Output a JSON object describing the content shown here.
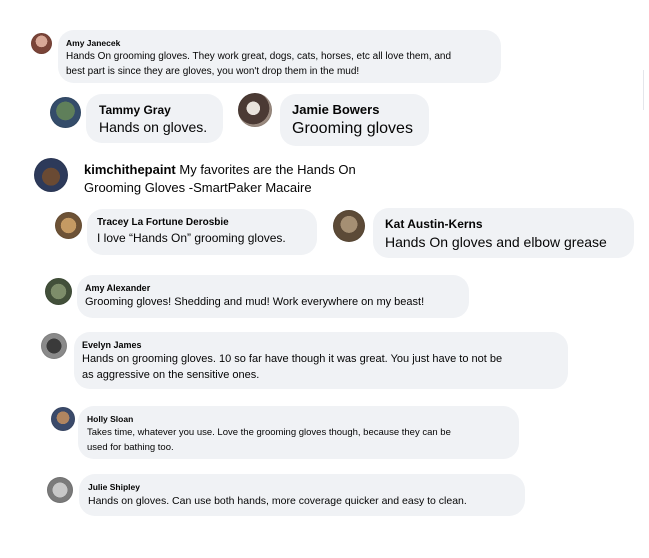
{
  "comments": [
    {
      "name": "Amy Janecek",
      "line1": "Hands On grooming gloves. They work great, dogs, cats, horses, etc all love them, and",
      "line2": "best part is since they are gloves, you won't drop them in the mud!"
    },
    {
      "name": "Tammy Gray",
      "line1": "Hands on gloves."
    },
    {
      "name": "Jamie Bowers",
      "line1": "Grooming gloves"
    },
    {
      "name": "kimchithepaint",
      "line1": "My favorites are the Hands On",
      "line2": "Grooming Gloves -SmartPaker Macaire"
    },
    {
      "name": "Tracey La Fortune Derosbie",
      "line1": "I love “Hands On” grooming gloves."
    },
    {
      "name": "Kat Austin-Kerns",
      "line1": "Hands On gloves and elbow grease"
    },
    {
      "name": "Amy Alexander",
      "line1": "Grooming gloves! Shedding and mud! Work everywhere on my beast!"
    },
    {
      "name": "Evelyn James",
      "line1": "Hands on grooming gloves. 10 so far have though it was great. You just have to not be",
      "line2": "as aggressive on the sensitive ones."
    },
    {
      "name": "Holly Sloan",
      "line1": "Takes time, whatever you use. Love the grooming gloves though, because they can be",
      "line2": "used for bathing too."
    },
    {
      "name": "Julie Shipley",
      "line1": "Hands on gloves. Can use both hands, more coverage quicker and easy to clean."
    }
  ]
}
